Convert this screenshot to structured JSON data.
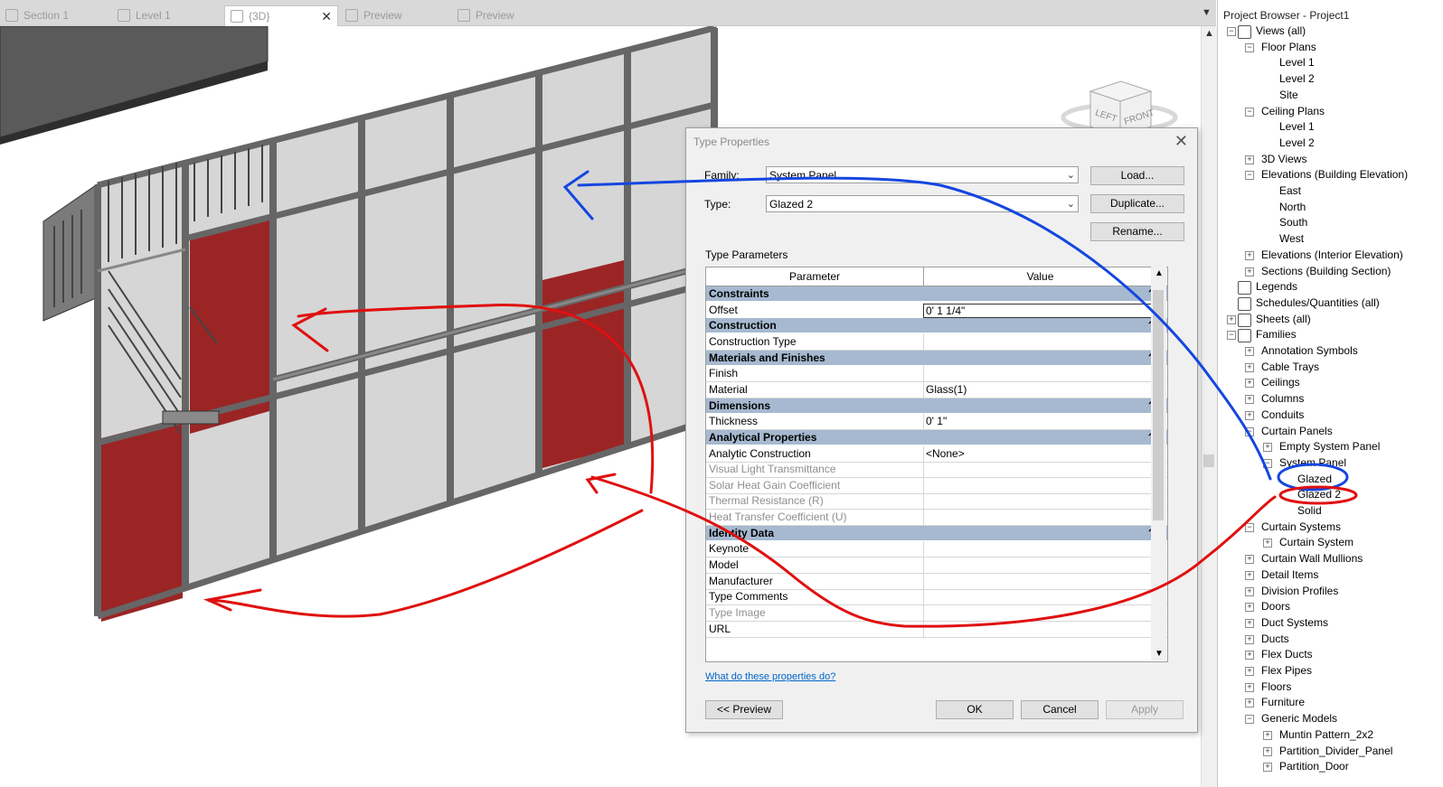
{
  "tabs": [
    {
      "label": "Section 1",
      "active": false
    },
    {
      "label": "Level 1",
      "active": false
    },
    {
      "label": "{3D}",
      "active": true
    },
    {
      "label": "Preview",
      "active": false
    },
    {
      "label": "Preview",
      "active": false
    }
  ],
  "project_browser": {
    "title": "Project Browser - Project1",
    "items": [
      {
        "label": "Views (all)",
        "level": 0,
        "toggle": "minus",
        "icon": "views-icon"
      },
      {
        "label": "Floor Plans",
        "level": 1,
        "toggle": "minus"
      },
      {
        "label": "Level 1",
        "level": 2
      },
      {
        "label": "Level 2",
        "level": 2
      },
      {
        "label": "Site",
        "level": 2
      },
      {
        "label": "Ceiling Plans",
        "level": 1,
        "toggle": "minus"
      },
      {
        "label": "Level 1",
        "level": 2
      },
      {
        "label": "Level 2",
        "level": 2
      },
      {
        "label": "3D Views",
        "level": 1,
        "toggle": "plus"
      },
      {
        "label": "Elevations (Building Elevation)",
        "level": 1,
        "toggle": "minus"
      },
      {
        "label": "East",
        "level": 2
      },
      {
        "label": "North",
        "level": 2
      },
      {
        "label": "South",
        "level": 2
      },
      {
        "label": "West",
        "level": 2
      },
      {
        "label": "Elevations (Interior Elevation)",
        "level": 1,
        "toggle": "plus"
      },
      {
        "label": "Sections (Building Section)",
        "level": 1,
        "toggle": "plus"
      },
      {
        "label": "Legends",
        "level": 0,
        "icon": "legend-icon"
      },
      {
        "label": "Schedules/Quantities (all)",
        "level": 0,
        "icon": "schedule-icon"
      },
      {
        "label": "Sheets (all)",
        "level": 0,
        "toggle": "plus",
        "icon": "sheet-icon"
      },
      {
        "label": "Families",
        "level": 0,
        "toggle": "minus",
        "icon": "family-icon"
      },
      {
        "label": "Annotation Symbols",
        "level": 1,
        "toggle": "plus"
      },
      {
        "label": "Cable Trays",
        "level": 1,
        "toggle": "plus"
      },
      {
        "label": "Ceilings",
        "level": 1,
        "toggle": "plus"
      },
      {
        "label": "Columns",
        "level": 1,
        "toggle": "plus"
      },
      {
        "label": "Conduits",
        "level": 1,
        "toggle": "plus"
      },
      {
        "label": "Curtain Panels",
        "level": 1,
        "toggle": "minus"
      },
      {
        "label": "Empty System Panel",
        "level": 2,
        "toggle": "plus"
      },
      {
        "label": "System Panel",
        "level": 2,
        "toggle": "minus"
      },
      {
        "label": "Glazed",
        "level": 3
      },
      {
        "label": "Glazed 2",
        "level": 3
      },
      {
        "label": "Solid",
        "level": 3
      },
      {
        "label": "Curtain Systems",
        "level": 1,
        "toggle": "minus"
      },
      {
        "label": "Curtain System",
        "level": 2,
        "toggle": "plus"
      },
      {
        "label": "Curtain Wall Mullions",
        "level": 1,
        "toggle": "plus"
      },
      {
        "label": "Detail Items",
        "level": 1,
        "toggle": "plus"
      },
      {
        "label": "Division Profiles",
        "level": 1,
        "toggle": "plus"
      },
      {
        "label": "Doors",
        "level": 1,
        "toggle": "plus"
      },
      {
        "label": "Duct Systems",
        "level": 1,
        "toggle": "plus"
      },
      {
        "label": "Ducts",
        "level": 1,
        "toggle": "plus"
      },
      {
        "label": "Flex Ducts",
        "level": 1,
        "toggle": "plus"
      },
      {
        "label": "Flex Pipes",
        "level": 1,
        "toggle": "plus"
      },
      {
        "label": "Floors",
        "level": 1,
        "toggle": "plus"
      },
      {
        "label": "Furniture",
        "level": 1,
        "toggle": "plus"
      },
      {
        "label": "Generic Models",
        "level": 1,
        "toggle": "minus"
      },
      {
        "label": "Muntin Pattern_2x2",
        "level": 2,
        "toggle": "plus"
      },
      {
        "label": "Partition_Divider_Panel",
        "level": 2,
        "toggle": "plus"
      },
      {
        "label": "Partition_Door",
        "level": 2,
        "toggle": "plus"
      }
    ]
  },
  "viewcube": {
    "left": "LEFT",
    "front": "FRONT"
  },
  "dialog": {
    "title": "Type Properties",
    "family_label": "Family:",
    "family_value": "System Panel",
    "type_label": "Type:",
    "type_value": "Glazed 2",
    "load_button": "Load...",
    "duplicate_button": "Duplicate...",
    "rename_button": "Rename...",
    "type_parameters_label": "Type Parameters",
    "col_parameter": "Parameter",
    "col_value": "Value",
    "col_eq": "=",
    "groups": [
      {
        "name": "Constraints",
        "rows": [
          {
            "p": "Offset",
            "v": "0'  1 1/4\"",
            "editing": true
          }
        ]
      },
      {
        "name": "Construction",
        "rows": [
          {
            "p": "Construction Type",
            "v": ""
          }
        ]
      },
      {
        "name": "Materials and Finishes",
        "rows": [
          {
            "p": "Finish",
            "v": ""
          },
          {
            "p": "Material",
            "v": "Glass(1)"
          }
        ]
      },
      {
        "name": "Dimensions",
        "rows": [
          {
            "p": "Thickness",
            "v": "0'  1\""
          }
        ]
      },
      {
        "name": "Analytical Properties",
        "rows": [
          {
            "p": "Analytic Construction",
            "v": "<None>"
          },
          {
            "p": "Visual Light Transmittance",
            "v": "",
            "dim": true
          },
          {
            "p": "Solar Heat Gain Coefficient",
            "v": "",
            "dim": true
          },
          {
            "p": "Thermal Resistance (R)",
            "v": "",
            "dim": true
          },
          {
            "p": "Heat Transfer Coefficient (U)",
            "v": "",
            "dim": true
          }
        ]
      },
      {
        "name": "Identity Data",
        "rows": [
          {
            "p": "Keynote",
            "v": ""
          },
          {
            "p": "Model",
            "v": ""
          },
          {
            "p": "Manufacturer",
            "v": ""
          },
          {
            "p": "Type Comments",
            "v": ""
          },
          {
            "p": "Type Image",
            "v": "",
            "dim": true
          },
          {
            "p": "URL",
            "v": ""
          }
        ]
      }
    ],
    "help_link": "What do these properties do?",
    "preview_button": "<< Preview",
    "ok_button": "OK",
    "cancel_button": "Cancel",
    "apply_button": "Apply"
  },
  "colors": {
    "panel_red": "#9b2525",
    "glass": "#d6d6d6",
    "mullion": "#6e6e6e",
    "annotation_red": "#e01010",
    "annotation_blue": "#1446e0",
    "group_header": "#a6b9d0"
  }
}
